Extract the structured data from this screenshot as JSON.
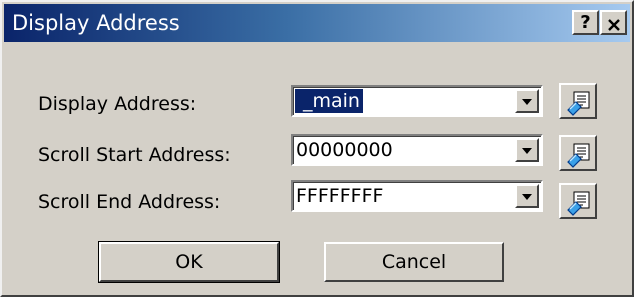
{
  "window": {
    "title": "Display Address",
    "help_label": "?",
    "close_label": "✕"
  },
  "fields": [
    {
      "label": "Display Address:",
      "value": "_main",
      "selected": true,
      "icon": "address-picker-icon"
    },
    {
      "label": "Scroll Start Address:",
      "value": "00000000",
      "selected": false,
      "icon": "address-picker-icon"
    },
    {
      "label": "Scroll End Address:",
      "value": "FFFFFFFF",
      "selected": false,
      "icon": "address-picker-icon"
    }
  ],
  "buttons": {
    "ok_label": "OK",
    "cancel_label": "Cancel"
  },
  "colors": {
    "title_start": "#0a246a",
    "title_end": "#a6caf0",
    "face": "#d4d0c8",
    "selection": "#0a246a"
  }
}
